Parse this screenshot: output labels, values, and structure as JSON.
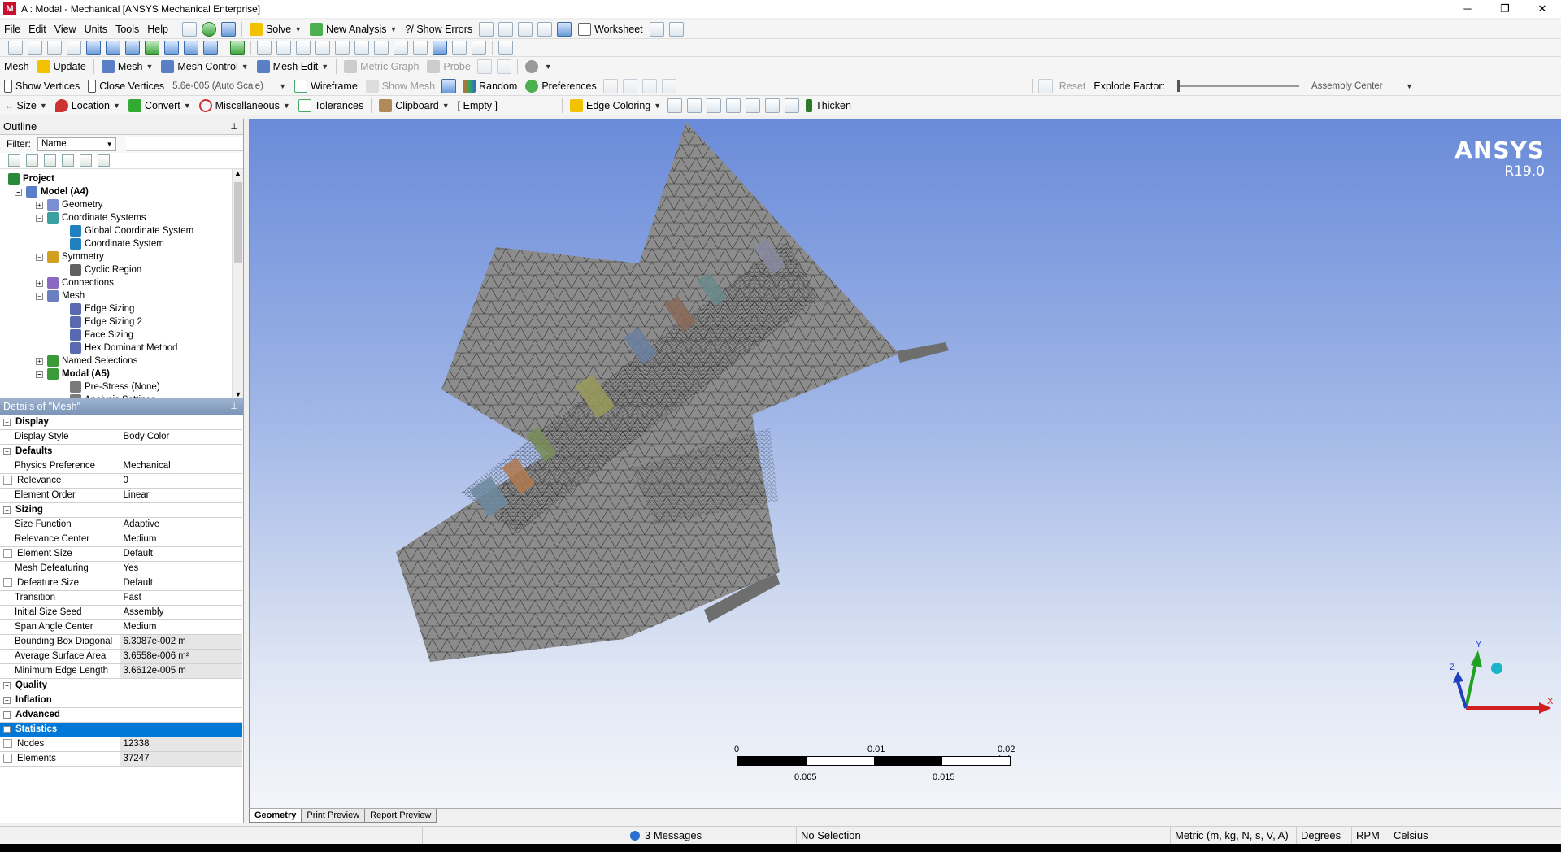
{
  "window": {
    "title": "A : Modal - Mechanical [ANSYS Mechanical Enterprise]",
    "app_icon_letter": "M",
    "controls": [
      "─",
      "❐",
      "✕"
    ]
  },
  "menubar": {
    "items": [
      "File",
      "Edit",
      "View",
      "Units",
      "Tools",
      "Help"
    ],
    "solve": "Solve",
    "new_analysis": "New Analysis",
    "show_errors": "?/ Show Errors",
    "worksheet": "Worksheet"
  },
  "mesh_toolbar": {
    "context": "Mesh",
    "update": "Update",
    "mesh": "Mesh",
    "mesh_control": "Mesh Control",
    "mesh_edit": "Mesh Edit",
    "metric_graph": "Metric Graph",
    "probe": "Probe"
  },
  "display_toolbar": {
    "show_vertices": "Show Vertices",
    "close_vertices": "Close Vertices",
    "auto_scale": "5.6e-005 (Auto Scale)",
    "wireframe": "Wireframe",
    "show_mesh": "Show Mesh",
    "random": "Random",
    "preferences": "Preferences",
    "reset": "Reset",
    "explode_factor": "Explode Factor:",
    "assembly_center": "Assembly Center"
  },
  "selection_toolbar": {
    "size": "Size",
    "location": "Location",
    "convert": "Convert",
    "miscellaneous": "Miscellaneous",
    "tolerances": "Tolerances",
    "clipboard": "Clipboard",
    "empty": "[ Empty ]",
    "edge_coloring": "Edge Coloring",
    "thicken": "Thicken"
  },
  "outline": {
    "title": "Outline",
    "filter_label": "Filter:",
    "filter_value": "Name",
    "tree": [
      {
        "label": "Project",
        "bold": true
      },
      {
        "label": "Model (A4)",
        "bold": true
      },
      {
        "label": "Geometry"
      },
      {
        "label": "Coordinate Systems"
      },
      {
        "label": "Global Coordinate System"
      },
      {
        "label": "Coordinate System"
      },
      {
        "label": "Symmetry"
      },
      {
        "label": "Cyclic Region"
      },
      {
        "label": "Connections"
      },
      {
        "label": "Mesh"
      },
      {
        "label": "Edge Sizing"
      },
      {
        "label": "Edge Sizing 2"
      },
      {
        "label": "Face Sizing"
      },
      {
        "label": "Hex Dominant Method"
      },
      {
        "label": "Named Selections"
      },
      {
        "label": "Modal (A5)",
        "bold": true
      },
      {
        "label": "Pre-Stress (None)"
      },
      {
        "label": "Analysis Settings"
      }
    ]
  },
  "details": {
    "title": "Details of \"Mesh\"",
    "sections": [
      {
        "name": "Display",
        "rows": [
          {
            "k": "Display Style",
            "v": "Body Color"
          }
        ]
      },
      {
        "name": "Defaults",
        "rows": [
          {
            "k": "Physics Preference",
            "v": "Mechanical"
          },
          {
            "k": "Relevance",
            "v": "0",
            "cb": true
          },
          {
            "k": "Element Order",
            "v": "Linear"
          }
        ]
      },
      {
        "name": "Sizing",
        "rows": [
          {
            "k": "Size Function",
            "v": "Adaptive"
          },
          {
            "k": "Relevance Center",
            "v": "Medium"
          },
          {
            "k": "Element Size",
            "v": "Default",
            "cb": true
          },
          {
            "k": "Mesh Defeaturing",
            "v": "Yes"
          },
          {
            "k": "Defeature Size",
            "v": "Default",
            "cb": true
          },
          {
            "k": "Transition",
            "v": "Fast"
          },
          {
            "k": "Initial Size Seed",
            "v": "Assembly"
          },
          {
            "k": "Span Angle Center",
            "v": "Medium"
          },
          {
            "k": "Bounding Box Diagonal",
            "v": "6.3087e-002 m",
            "grey": true
          },
          {
            "k": "Average Surface Area",
            "v": "3.6558e-006 m²",
            "grey": true
          },
          {
            "k": "Minimum Edge Length",
            "v": "3.6612e-005 m",
            "grey": true
          }
        ]
      },
      {
        "name": "Quality",
        "rows": []
      },
      {
        "name": "Inflation",
        "rows": []
      },
      {
        "name": "Advanced",
        "rows": []
      },
      {
        "name": "Statistics",
        "selected": true,
        "rows": [
          {
            "k": "Nodes",
            "v": "12338",
            "cb": true,
            "grey": true
          },
          {
            "k": "Elements",
            "v": "37247",
            "cb": true,
            "grey": true
          }
        ]
      }
    ]
  },
  "viewport": {
    "brand": "ANSYS",
    "version": "R19.0",
    "scale": {
      "top_labels": [
        "0",
        "0.01",
        "0.02 (m)"
      ],
      "bottom_labels": [
        "0.005",
        "0.015"
      ]
    },
    "axes": {
      "x": "X",
      "y": "Y",
      "z": "Z"
    }
  },
  "view_tabs": [
    "Geometry",
    "Print Preview",
    "Report Preview"
  ],
  "status": {
    "messages": "3 Messages",
    "selection": "No Selection",
    "units": "Metric (m, kg, N, s, V, A)",
    "angle": "Degrees",
    "rpm": "RPM",
    "temp": "Celsius"
  },
  "colors": {
    "selection_blue": "#0078d7",
    "viewport_top": "#6a8bd9",
    "viewport_bottom": "#f3f5fa",
    "mesh_fill": "#8a8a8a"
  }
}
